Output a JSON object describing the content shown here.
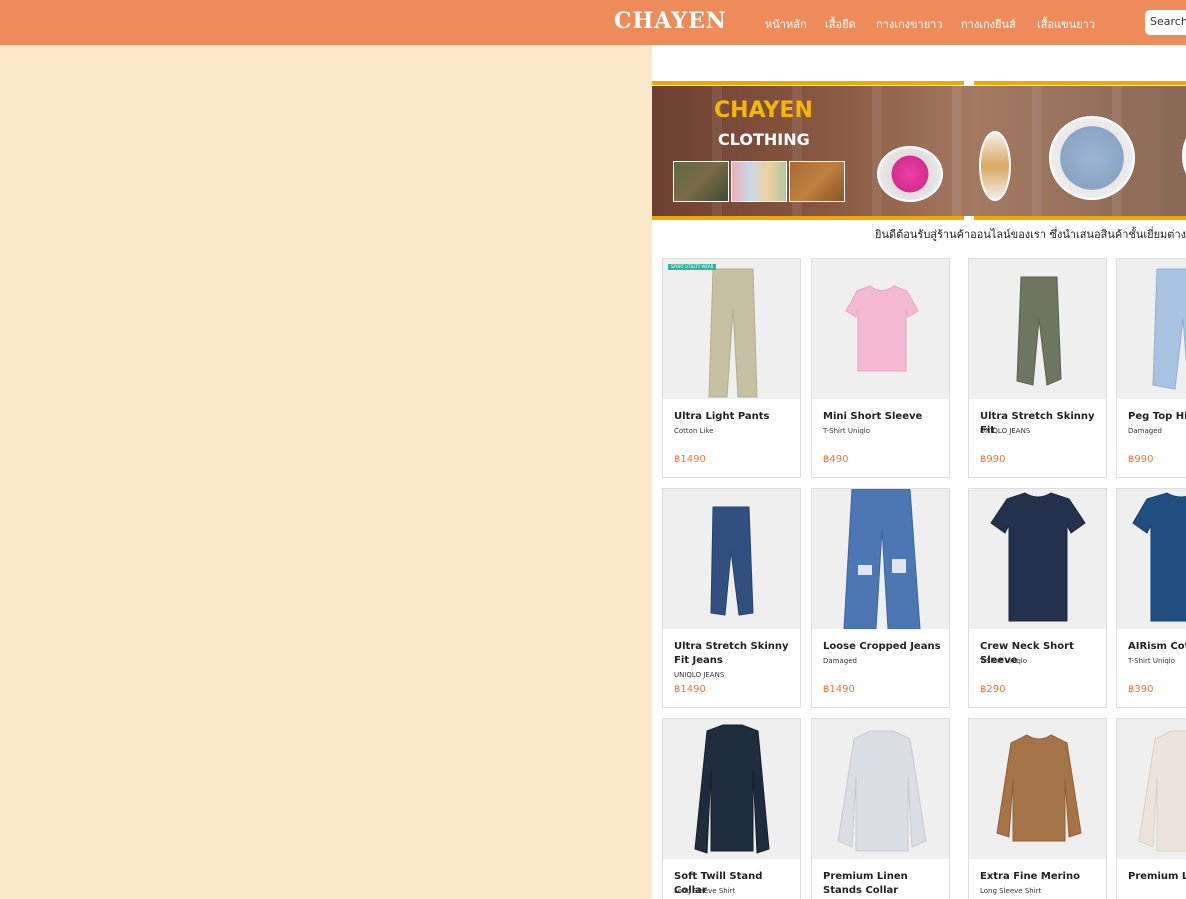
{
  "header": {
    "brand": "CHAYEN",
    "nav": [
      "หน้าหลัก",
      "เสื้อยืด",
      "กางเกงขายาว",
      "กางเกงยีนส์",
      "เสื้อแขนยาว"
    ],
    "search_placeholder": "Search"
  },
  "banner": {
    "title": "CHAYEN",
    "subtitle": "CLOTHING"
  },
  "welcome_text": "ยินดีต้อนรับสู่ร้านค้าออนไลน์ของเรา ซึ่งนำเสนอสินค้าชั้นเยี่ยมต่าง",
  "products": [
    {
      "name": "Ultra Light Pants",
      "sub": "Cotton Like",
      "price": "฿1490",
      "tag": "SPORT UTILITY WEAR"
    },
    {
      "name": "Mini Short Sleeve",
      "sub": "T-Shirt Uniqlo",
      "price": "฿490"
    },
    {
      "name": "Ultra Stretch Skinny Fit",
      "sub": "UNIQLO JEANS",
      "price": "฿990"
    },
    {
      "name": "Peg Top High",
      "sub": "Damaged",
      "price": "฿990"
    },
    {
      "name": "Ultra Stretch Skinny Fit Jeans",
      "sub": "UNIQLO JEANS",
      "price": "฿1490"
    },
    {
      "name": "Loose Cropped Jeans",
      "sub": "Damaged",
      "price": "฿1490"
    },
    {
      "name": "Crew Neck Short Sleeve",
      "sub": "T-Shirt Uniqlo",
      "price": "฿290"
    },
    {
      "name": "AIRism Cotto",
      "sub": "T-Shirt Uniqlo",
      "price": "฿390"
    },
    {
      "name": "Soft Twill Stand Collar",
      "sub": "Long Sleeve Shirt",
      "price": ""
    },
    {
      "name": "Premium Linen Stands Collar Striped",
      "sub": "",
      "price": ""
    },
    {
      "name": "Extra Fine Merino",
      "sub": "Long Sleeve Shirt",
      "price": ""
    },
    {
      "name": "Premium Lin Collar",
      "sub": "",
      "price": ""
    }
  ]
}
